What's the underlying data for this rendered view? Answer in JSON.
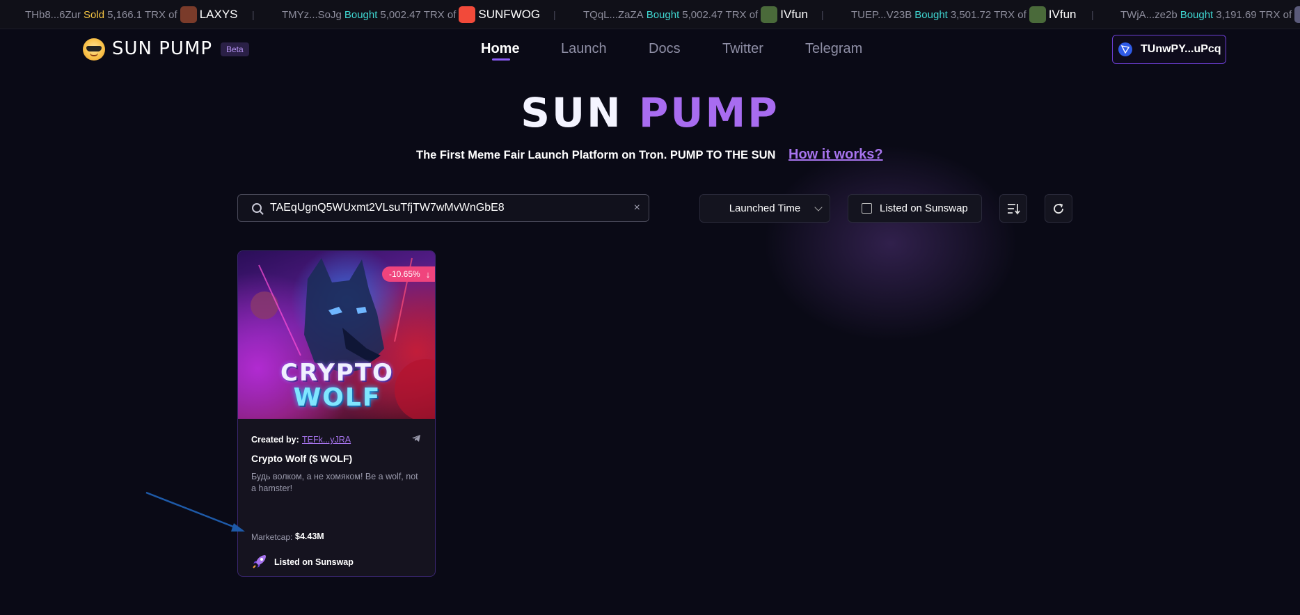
{
  "ticker": [
    {
      "addr": "THb8...6Zur",
      "action": "Sold",
      "amount": "5,166.1 TRX of",
      "token": "LAXYS",
      "logo_color": "#7a3b2a"
    },
    {
      "addr": "TMYz...SoJg",
      "action": "Bought",
      "amount": "5,002.47 TRX of",
      "token": "SUNFWOG",
      "logo_color": "#f24a3a"
    },
    {
      "addr": "TQqL...ZaZA",
      "action": "Bought",
      "amount": "5,002.47 TRX of",
      "token": "IVfun",
      "logo_color": "#4a6a3a"
    },
    {
      "addr": "TUEP...V23B",
      "action": "Bought",
      "amount": "3,501.72 TRX of",
      "token": "IVfun",
      "logo_color": "#4a6a3a"
    },
    {
      "addr": "TWjA...ze2b",
      "action": "Bought",
      "amount": "3,191.69 TRX of",
      "token": "",
      "logo_color": "#5a5a7a"
    }
  ],
  "header": {
    "logo_text": "SUN PUMP",
    "beta_label": "Beta",
    "nav": {
      "home": "Home",
      "launch": "Launch",
      "docs": "Docs",
      "twitter": "Twitter",
      "telegram": "Telegram"
    },
    "wallet": "TUnwPY...uPcq"
  },
  "hero": {
    "title_part1": "SUN",
    "title_part2": "PUMP",
    "tagline": "The First Meme Fair Launch Platform on Tron. PUMP TO THE SUN",
    "how_it_works": "How it works?"
  },
  "controls": {
    "search_value": "TAEqUgnQ5WUxmt2VLsuTfjTW7wMvWnGbE8",
    "clear_symbol": "×",
    "sort_selected": "Launched Time",
    "listed_filter_label": "Listed on Sunswap",
    "listed_filter_checked": false
  },
  "card": {
    "image_text_line1": "CRYPTO",
    "image_text_line2": "WOLF",
    "change": "-10.65%",
    "change_arrow": "↓",
    "created_by_label": "Created by:",
    "creator": "TEFk...yJRA",
    "name": "Crypto Wolf ($ WOLF)",
    "description": "Будь волком, а не хомяком! Be a wolf, not a hamster!",
    "marketcap_label": "Marketcap:",
    "marketcap_value": "$4.43M",
    "listed_label": "Listed on Sunswap"
  },
  "colors": {
    "accent": "#8b5cf6",
    "sold": "#f5c542",
    "bought": "#3fd6d1",
    "negative_badge": "#f0447d",
    "annotation_arrow": "#1e5aa8"
  }
}
